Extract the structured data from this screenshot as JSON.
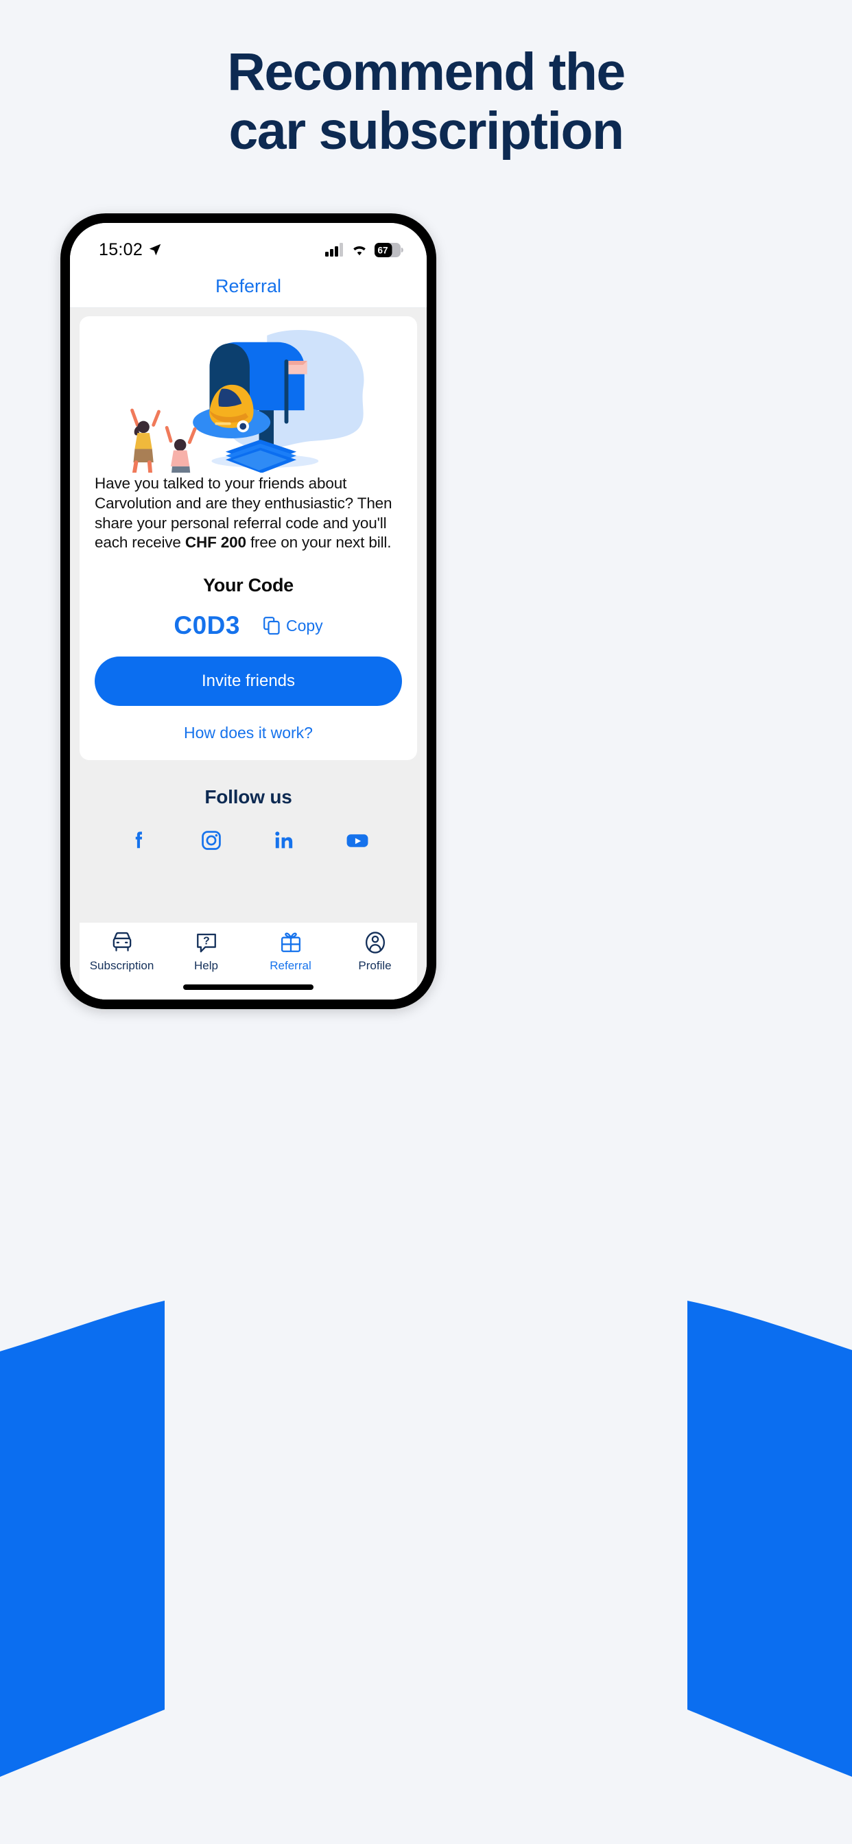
{
  "marketing": {
    "headline_line1": "Recommend the",
    "headline_line2": "car subscription",
    "headline_color": "#0d2a52",
    "background_color": "#f3f5f9",
    "accent_wedge_color": "#0b6ef0"
  },
  "phone": {
    "status_bar": {
      "time": "15:02",
      "location_icon": "location-arrow-icon",
      "cellular_icon": "cellular-signal-icon",
      "cellular_bars_filled": 3,
      "cellular_bars_total": 4,
      "wifi_icon": "wifi-icon",
      "battery_icon": "battery-icon",
      "battery_percent": "67"
    },
    "nav": {
      "title": "Referral",
      "title_color": "#1572ec"
    },
    "card": {
      "illustration_name": "mailbox-car-referral-illustration",
      "body_text_part1": "Have you talked to your friends about Carvolution and are they enthusiastic? Then share your personal referral code and you'll each receive ",
      "body_text_bold": "CHF 200",
      "body_text_part2": " free on your next bill.",
      "your_code_label": "Your Code",
      "code_value": "C0D3",
      "copy_label": "Copy",
      "copy_icon": "copy-icon",
      "cta_label": "Invite friends",
      "cta_color": "#0b6ef0",
      "how_link_label": "How does it work?"
    },
    "follow": {
      "title": "Follow us",
      "icon_color": "#1572ec",
      "socials": [
        {
          "name": "facebook-icon",
          "label": "Facebook"
        },
        {
          "name": "instagram-icon",
          "label": "Instagram"
        },
        {
          "name": "linkedin-icon",
          "label": "LinkedIn"
        },
        {
          "name": "youtube-icon",
          "label": "YouTube"
        }
      ]
    },
    "tabbar": {
      "active_color": "#1572ec",
      "inactive_color": "#14305a",
      "tabs": [
        {
          "label": "Subscription",
          "icon": "car-icon",
          "active": false
        },
        {
          "label": "Help",
          "icon": "question-bubble-icon",
          "active": false
        },
        {
          "label": "Referral",
          "icon": "gift-icon",
          "active": true
        },
        {
          "label": "Profile",
          "icon": "person-circle-icon",
          "active": false
        }
      ]
    }
  }
}
